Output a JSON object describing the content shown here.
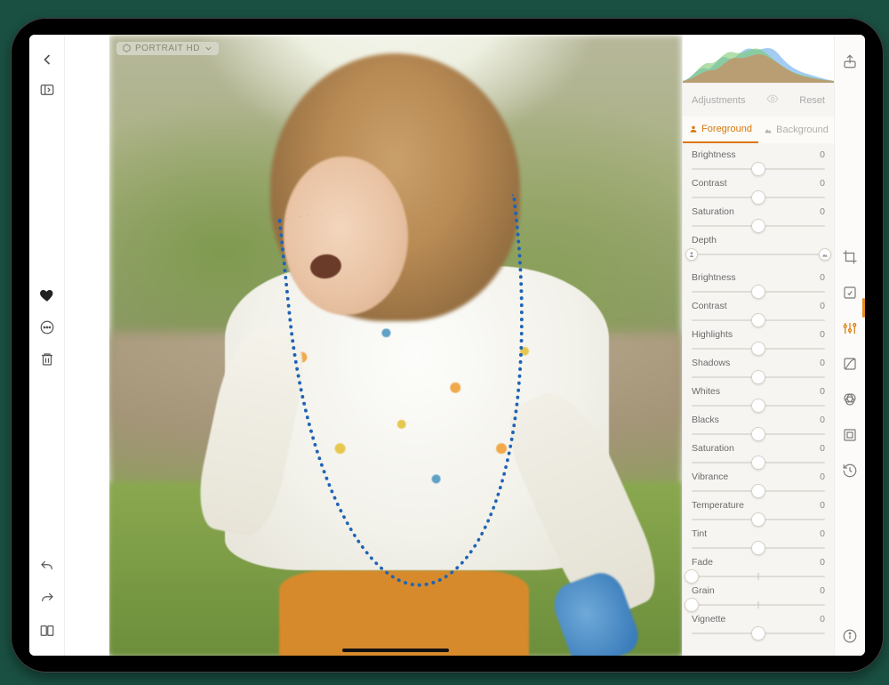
{
  "badge": {
    "label": "PORTRAIT HD"
  },
  "panel": {
    "title": "Adjustments",
    "reset": "Reset",
    "tabs": {
      "foreground": "Foreground",
      "background": "Background",
      "active": "foreground"
    }
  },
  "sliders_a": [
    {
      "name": "Brightness",
      "value": 0,
      "pos": 50
    },
    {
      "name": "Contrast",
      "value": 0,
      "pos": 50
    },
    {
      "name": "Saturation",
      "value": 0,
      "pos": 50
    }
  ],
  "depth": {
    "name": "Depth",
    "start": 0,
    "end": 100
  },
  "sliders_b": [
    {
      "name": "Brightness",
      "value": 0,
      "pos": 50
    },
    {
      "name": "Contrast",
      "value": 0,
      "pos": 50
    },
    {
      "name": "Highlights",
      "value": 0,
      "pos": 50
    },
    {
      "name": "Shadows",
      "value": 0,
      "pos": 50
    },
    {
      "name": "Whites",
      "value": 0,
      "pos": 50
    },
    {
      "name": "Blacks",
      "value": 0,
      "pos": 50
    },
    {
      "name": "Saturation",
      "value": 0,
      "pos": 50
    },
    {
      "name": "Vibrance",
      "value": 0,
      "pos": 50
    },
    {
      "name": "Temperature",
      "value": 0,
      "pos": 50
    },
    {
      "name": "Tint",
      "value": 0,
      "pos": 50
    },
    {
      "name": "Fade",
      "value": 0,
      "pos": 0
    },
    {
      "name": "Grain",
      "value": 0,
      "pos": 0
    },
    {
      "name": "Vignette",
      "value": 0,
      "pos": 50
    }
  ]
}
